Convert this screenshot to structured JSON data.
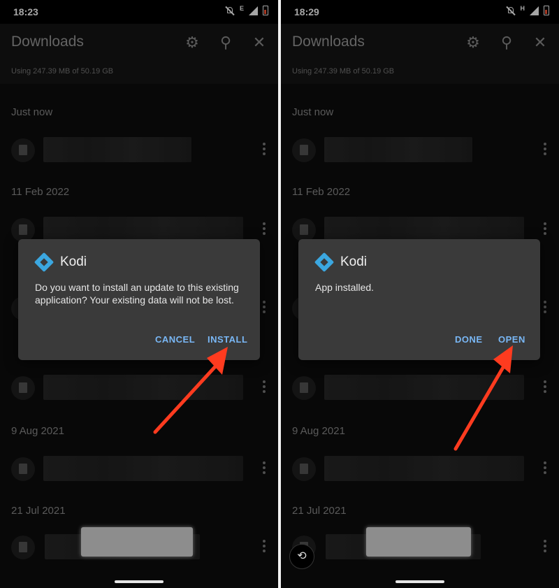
{
  "left": {
    "status": {
      "time": "18:23",
      "network": "E"
    },
    "header": {
      "title": "Downloads",
      "storage": "Using 247.39 MB of 50.19 GB"
    },
    "sections": [
      {
        "date": "Just now"
      },
      {
        "date": "11 Feb 2022"
      },
      {
        "date": "9 Aug 2021"
      },
      {
        "date": "21 Jul 2021"
      }
    ],
    "dialog": {
      "app_name": "Kodi",
      "message": "Do you want to install an update to this existing application? Your existing data will not be lost.",
      "buttons": [
        "CANCEL",
        "INSTALL"
      ]
    }
  },
  "right": {
    "status": {
      "time": "18:29",
      "network": "H"
    },
    "header": {
      "title": "Downloads",
      "storage": "Using 247.39 MB of 50.19 GB"
    },
    "sections": [
      {
        "date": "Just now"
      },
      {
        "date": "11 Feb 2022"
      },
      {
        "date": "9 Aug 2021"
      },
      {
        "date": "21 Jul 2021"
      }
    ],
    "dialog": {
      "app_name": "Kodi",
      "message": "App installed.",
      "buttons": [
        "DONE",
        "OPEN"
      ]
    }
  },
  "colors": {
    "accent": "#79b7f5",
    "arrow": "#ff3b1f",
    "kodi": "#3ba7e0"
  },
  "icons": [
    "settings-gear-icon",
    "search-icon",
    "close-icon",
    "file-icon",
    "more-vert-icon",
    "kodi-logo-icon",
    "rotate-icon"
  ]
}
